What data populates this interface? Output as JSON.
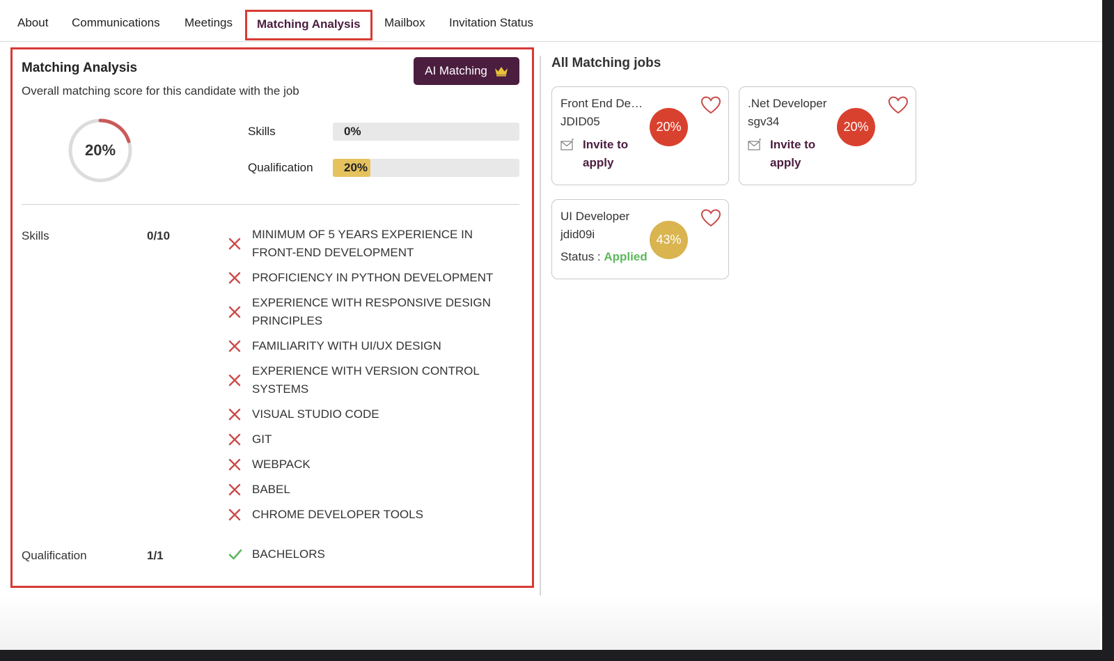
{
  "tabs": [
    {
      "label": "About",
      "active": false
    },
    {
      "label": "Communications",
      "active": false
    },
    {
      "label": "Meetings",
      "active": false
    },
    {
      "label": "Matching Analysis",
      "active": true
    },
    {
      "label": "Mailbox",
      "active": false
    },
    {
      "label": "Invitation Status",
      "active": false
    }
  ],
  "analysis": {
    "title": "Matching Analysis",
    "subtitle": "Overall matching score for this candidate with the job",
    "ai_button_label": "AI Matching",
    "ai_button_icon": "crown-icon",
    "overall_score": 20,
    "overall_label": "20%",
    "bars": [
      {
        "label": "Skills",
        "value": 0,
        "text": "0%"
      },
      {
        "label": "Qualification",
        "value": 20,
        "text": "20%"
      }
    ],
    "skills": {
      "label": "Skills",
      "score": "0/10",
      "items": [
        {
          "text": "MINIMUM OF 5 YEARS EXPERIENCE IN FRONT-END DEVELOPMENT",
          "matched": false
        },
        {
          "text": "PROFICIENCY IN PYTHON DEVELOPMENT",
          "matched": false
        },
        {
          "text": "EXPERIENCE WITH RESPONSIVE DESIGN PRINCIPLES",
          "matched": false
        },
        {
          "text": "FAMILIARITY WITH UI/UX DESIGN",
          "matched": false
        },
        {
          "text": "EXPERIENCE WITH VERSION CONTROL SYSTEMS",
          "matched": false
        },
        {
          "text": "VISUAL STUDIO CODE",
          "matched": false
        },
        {
          "text": "GIT",
          "matched": false
        },
        {
          "text": "WEBPACK",
          "matched": false
        },
        {
          "text": "BABEL",
          "matched": false
        },
        {
          "text": "CHROME DEVELOPER TOOLS",
          "matched": false
        }
      ]
    },
    "qualification": {
      "label": "Qualification",
      "score": "1/1",
      "items": [
        {
          "text": "BACHELORS",
          "matched": true
        }
      ]
    }
  },
  "jobs": {
    "title": "All Matching jobs",
    "cards": [
      {
        "title": "Front End De…",
        "id": "JDID05",
        "score": "20%",
        "score_color": "#d9412f",
        "action": "Invite to apply"
      },
      {
        "title": ".Net Developer",
        "id": "sgv34",
        "score": "20%",
        "score_color": "#d9412f",
        "action": "Invite to apply"
      },
      {
        "title": "UI Developer",
        "id": "jdid09i",
        "score": "43%",
        "score_color": "#d9b44f",
        "status_label": "Status :",
        "status_value": "Applied"
      }
    ]
  },
  "colors": {
    "accent": "#4b1d3f",
    "highlight_border": "#d83a35",
    "miss": "#cc4b4b",
    "match": "#5cb85c",
    "bar_fill": "#e6c25d"
  }
}
